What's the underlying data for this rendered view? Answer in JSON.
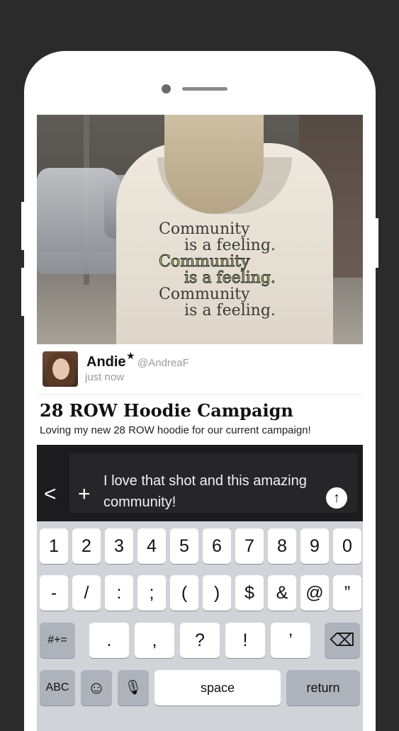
{
  "post": {
    "image_text": {
      "lines": [
        "Community",
        "is a feeling.",
        "Community",
        "is a feeling.",
        "Community",
        "is a feeling."
      ]
    },
    "author": {
      "name": "Andie",
      "verified_mark": "★",
      "handle": "@AndreaF",
      "time": "just now"
    },
    "title": "28 ROW Hoodie Campaign",
    "body": "Loving my new 28 ROW hoodie for our current campaign!"
  },
  "compose": {
    "back_icon": "chevron-left-icon",
    "back_glyph": "<",
    "add_icon": "plus-icon",
    "add_glyph": "+",
    "text": "I love that shot and this amazing community!",
    "send_icon": "arrow-up-icon",
    "send_glyph": "↑"
  },
  "keyboard": {
    "row1": [
      "1",
      "2",
      "3",
      "4",
      "5",
      "6",
      "7",
      "8",
      "9",
      "0"
    ],
    "row2": [
      "-",
      "/",
      ":",
      ";",
      "(",
      ")",
      "$",
      "&",
      "@",
      "”"
    ],
    "row3": {
      "mode_key": "#+=",
      "keys": [
        ".",
        ",",
        "?",
        "!",
        "’"
      ],
      "delete_icon": "backspace-icon",
      "delete_glyph": "⌫"
    },
    "row4": {
      "abc": "ABC",
      "emoji_icon": "emoji-icon",
      "emoji_glyph": "☺",
      "mic_icon": "microphone-icon",
      "mic_glyph": "🎙",
      "space": "space",
      "return": "return"
    }
  }
}
